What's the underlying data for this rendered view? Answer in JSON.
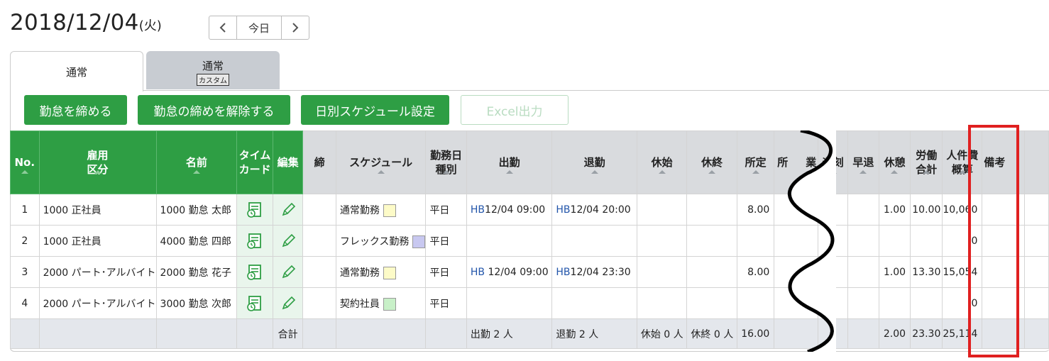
{
  "header": {
    "date": "2018/12/04",
    "dow": "(火)",
    "prev": "‹",
    "today": "今日",
    "next": "›"
  },
  "tabs": [
    {
      "label": "通常"
    },
    {
      "label": "通常",
      "sub": "カスタム"
    }
  ],
  "buttons": {
    "close": "勤怠を締める",
    "unclose": "勤怠の締めを解除する",
    "schedule": "日別スケジュール設定",
    "excel": "Excel出力"
  },
  "columns": {
    "no": "No.",
    "emp_type1": "雇用",
    "emp_type2": "区分",
    "name": "名前",
    "timecard1": "タイム",
    "timecard2": "カード",
    "edit": "編集",
    "close": "締",
    "schedule": "スケジュール",
    "daytype1": "勤務日",
    "daytype2": "種別",
    "in": "出勤",
    "out": "退勤",
    "break_start": "休始",
    "break_end": "休終",
    "scheduled": "所定",
    "hidden": "所",
    "hidden2": "業",
    "late": "遅刻",
    "early": "早退",
    "rest": "休憩",
    "work1": "労働",
    "work2": "合計",
    "cost1": "人件費",
    "cost2": "概算",
    "memo": "備考"
  },
  "rows": [
    {
      "no": "1",
      "emp": "1000 正社員",
      "name": "1000 勤怠 太郎",
      "schedule": "通常勤務",
      "swatch": "#fdfbc8",
      "daytype": "平日",
      "in_hb": "HB",
      "in": "12/04 09:00",
      "out_hb": "HB",
      "out": "12/04 20:00",
      "scheduled": "8.00",
      "rest": "1.00",
      "work": "10.00",
      "cost": "10,060"
    },
    {
      "no": "2",
      "emp": "1000 正社員",
      "name": "4000 勤怠 四郎",
      "schedule": "フレックス勤務",
      "swatch": "#c8c8f0",
      "daytype": "平日",
      "in_hb": "",
      "in": "",
      "out_hb": "",
      "out": "",
      "scheduled": "",
      "rest": "",
      "work": "",
      "cost": "0"
    },
    {
      "no": "3",
      "emp": "2000 パート･アルバイト",
      "name": "2000 勤怠 花子",
      "schedule": "通常勤務",
      "swatch": "#fdfbc8",
      "daytype": "平日",
      "in_hb": "HB",
      "in": " 12/04 09:00",
      "out_hb": "HB",
      "out": "12/04 23:30",
      "scheduled": "8.00",
      "rest": "1.00",
      "work": "13.30",
      "cost": "15,054"
    },
    {
      "no": "4",
      "emp": "2000 パート･アルバイト",
      "name": "3000 勤怠 次郎",
      "schedule": "契約社員",
      "swatch": "#c8f0c8",
      "daytype": "平日",
      "in_hb": "",
      "in": "",
      "out_hb": "",
      "out": "",
      "scheduled": "",
      "rest": "",
      "work": "",
      "cost": "0"
    }
  ],
  "totals": {
    "label": "合計",
    "in": "出勤 2 人",
    "out": "退勤 2 人",
    "break_start": "休始 0 人",
    "break_end": "休終 0 人",
    "scheduled": "16.00",
    "rest": "2.00",
    "work": "23.30",
    "cost": "25,114"
  }
}
